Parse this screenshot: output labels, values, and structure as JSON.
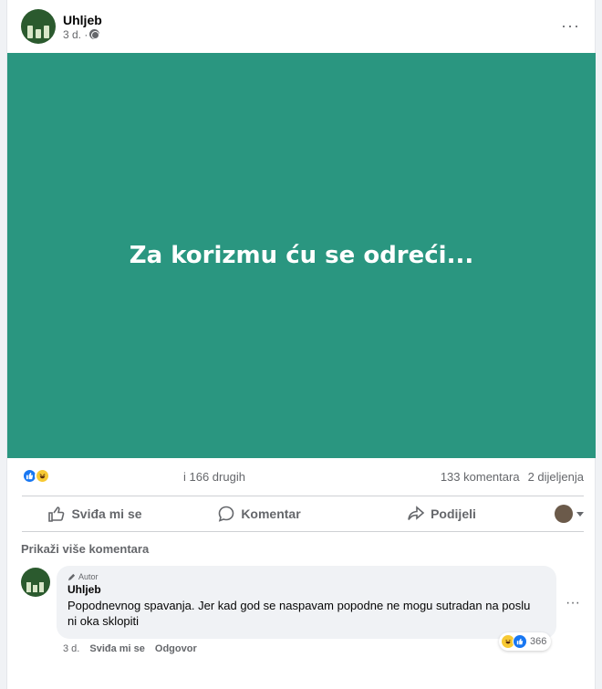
{
  "post": {
    "author": "Uhljeb",
    "time": "3 d. ·",
    "more_label": "···",
    "image_text": "Za korizmu ću se odreći...",
    "image_bg": "#2a9680"
  },
  "stats": {
    "reactions": [
      "like-reaction-icon",
      "haha-reaction-icon"
    ],
    "others": "i 166 drugih",
    "comments": "133 komentara",
    "shares": "2 dijeljenja"
  },
  "actions": {
    "like": "Sviđa mi se",
    "comment": "Komentar",
    "share": "Podijeli"
  },
  "comments_section": {
    "show_more": "Prikaži više komentara",
    "comment": {
      "badge": "Autor",
      "author": "Uhljeb",
      "text": "Popodnevnog spavanja. Jer kad god se naspavam popodne ne mogu sutradan na poslu ni oka sklopiti",
      "reaction_count": "366",
      "time": "3 d.",
      "like_label": "Sviđa mi se",
      "reply_label": "Odgovor",
      "more_label": "···"
    }
  }
}
